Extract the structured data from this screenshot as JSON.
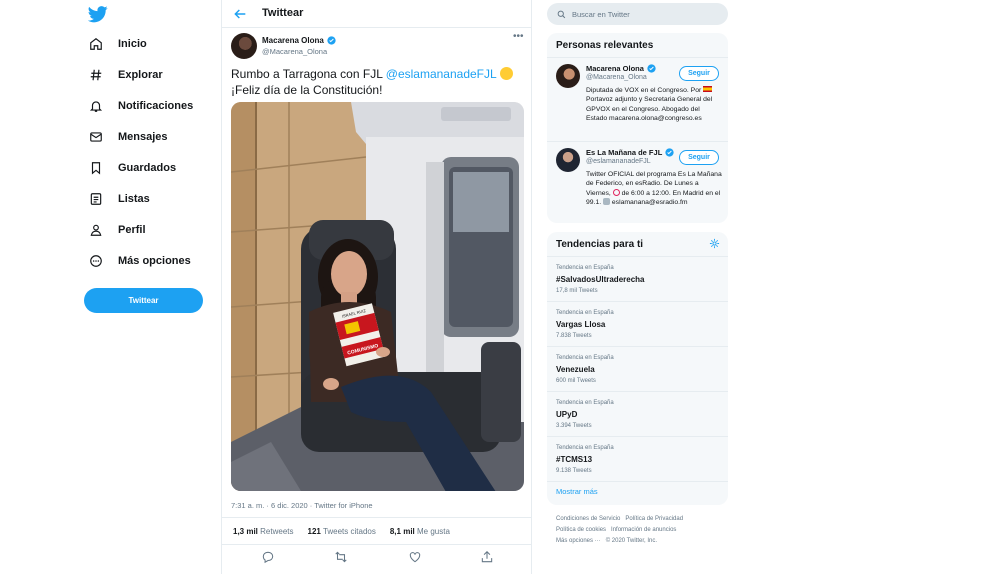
{
  "nav": {
    "items": [
      {
        "label": "Inicio",
        "icon": "home-icon"
      },
      {
        "label": "Explorar",
        "icon": "hashtag-icon"
      },
      {
        "label": "Notificaciones",
        "icon": "bell-icon"
      },
      {
        "label": "Mensajes",
        "icon": "envelope-icon"
      },
      {
        "label": "Guardados",
        "icon": "bookmark-icon"
      },
      {
        "label": "Listas",
        "icon": "list-icon"
      },
      {
        "label": "Perfil",
        "icon": "person-icon"
      },
      {
        "label": "Más opciones",
        "icon": "more-circle-icon"
      }
    ],
    "tweet_button": "Twittear"
  },
  "header": {
    "title": "Twittear"
  },
  "tweet": {
    "author_name": "Macarena Olona",
    "author_handle": "@Macarena_Olona",
    "text_before": "Rumbo a Tarragona con FJL ",
    "mention": "@eslamananadeFJL",
    "text_line2": "¡Feliz día de la Constitución!",
    "meta": "7:31 a. m. · 6 dic. 2020 · Twitter for iPhone",
    "stats": {
      "retweets_count": "1,3 mil",
      "retweets_label": "Retweets",
      "quotes_count": "121",
      "quotes_label": "Tweets citados",
      "likes_count": "8,1 mil",
      "likes_label": "Me gusta"
    },
    "book_title_top": "ISRAEL RUIZ",
    "book_title_bottom": "COMUNISMO"
  },
  "search": {
    "placeholder": "Buscar en Twitter"
  },
  "relevant": {
    "title": "Personas relevantes",
    "follow_label": "Seguir",
    "people": [
      {
        "name": "Macarena Olona",
        "handle": "@Macarena_Olona",
        "bio_1": "Diputada de VOX en el Congreso. Por ",
        "bio_2": " Portavoz adjunto y Secretaria General del GPVOX en el Congreso. Abogado del Estado macarena.olona@congreso.es"
      },
      {
        "name": "Es La Mañana de FJL",
        "handle": "@eslamananadeFJL",
        "bio_1": "Twitter OFICIAL del programa Es La Mañana de Federico, en esRadio. De Lunes a Viernes, ",
        "bio_2": " de 6:00 a 12:00. En Madrid en el 99.1. ",
        "bio_3": " eslamanana@esradio.fm"
      }
    ]
  },
  "trends": {
    "title": "Tendencias para ti",
    "items": [
      {
        "context": "Tendencia en España",
        "name": "#SalvadosUltraderecha",
        "count": "17,8 mil Tweets"
      },
      {
        "context": "Tendencia en España",
        "name": "Vargas Llosa",
        "count": "7.838 Tweets"
      },
      {
        "context": "Tendencia en España",
        "name": "Venezuela",
        "count": "600 mil Tweets"
      },
      {
        "context": "Tendencia en España",
        "name": "UPyD",
        "count": "3.394 Tweets"
      },
      {
        "context": "Tendencia en España",
        "name": "#TCMS13",
        "count": "9.138 Tweets"
      }
    ],
    "show_more": "Mostrar más"
  },
  "footer": {
    "terms": "Condiciones de Servicio",
    "privacy": "Política de Privacidad",
    "cookies": "Política de cookies",
    "ads": "Información de anuncios",
    "more": "Más opciones ···",
    "copyright": "© 2020 Twitter, Inc."
  },
  "colors": {
    "accent": "#1da1f2",
    "text": "#14171a",
    "secondary": "#657786",
    "panel": "#f5f8fa"
  }
}
